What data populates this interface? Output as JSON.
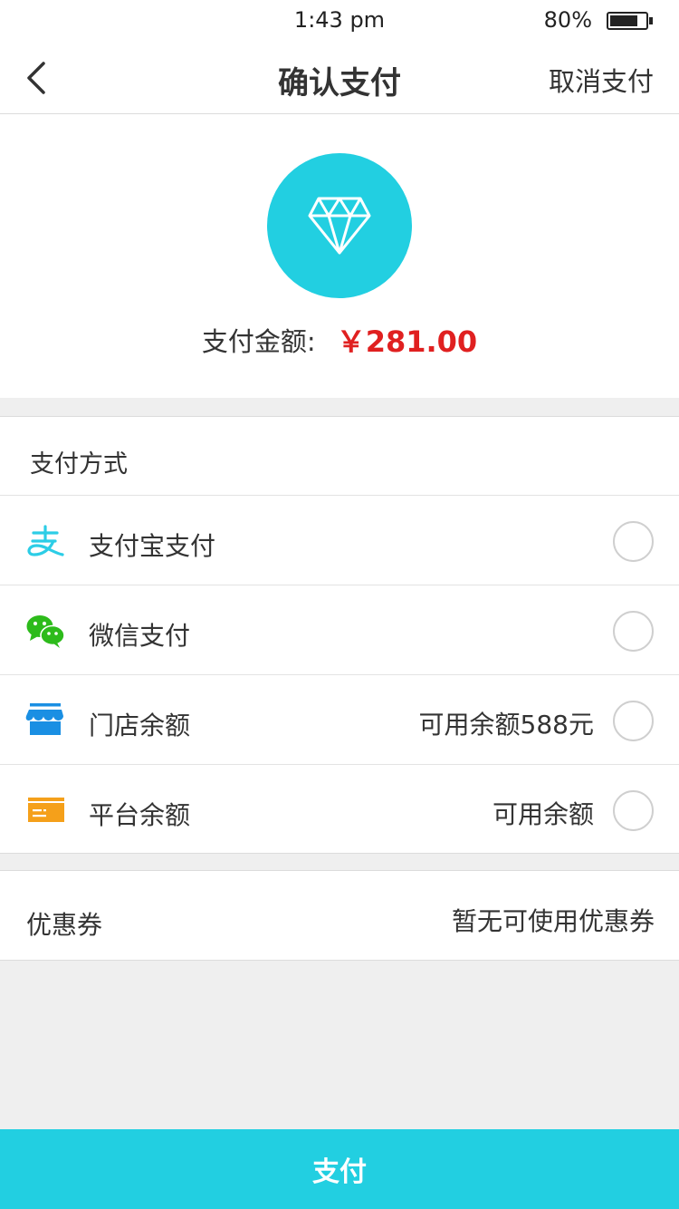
{
  "status_bar": {
    "time": "1:43 pm",
    "battery_text": "80%",
    "battery_level": 0.8
  },
  "nav": {
    "title": "确认支付",
    "cancel_label": "取消支付"
  },
  "summary": {
    "amount_label": "支付金额:",
    "amount_value": "￥281.00"
  },
  "payment_methods": {
    "title": "支付方式",
    "items": [
      {
        "icon": "alipay-icon",
        "label": "支付宝支付",
        "note": ""
      },
      {
        "icon": "wechat-icon",
        "label": "微信支付",
        "note": ""
      },
      {
        "icon": "store-icon",
        "label": "门店余额",
        "note": "可用余额588元"
      },
      {
        "icon": "wallet-icon",
        "label": "平台余额",
        "note": "可用余额"
      }
    ]
  },
  "coupon": {
    "label": "优惠券",
    "value": "暂无可使用优惠券"
  },
  "pay_button": {
    "label": "支付"
  },
  "colors": {
    "accent": "#22cfe1",
    "price": "#e02020",
    "alipay": "#2ccde6",
    "wechat": "#2dbb1b",
    "store": "#1a8fe3",
    "wallet": "#f5a01a"
  }
}
